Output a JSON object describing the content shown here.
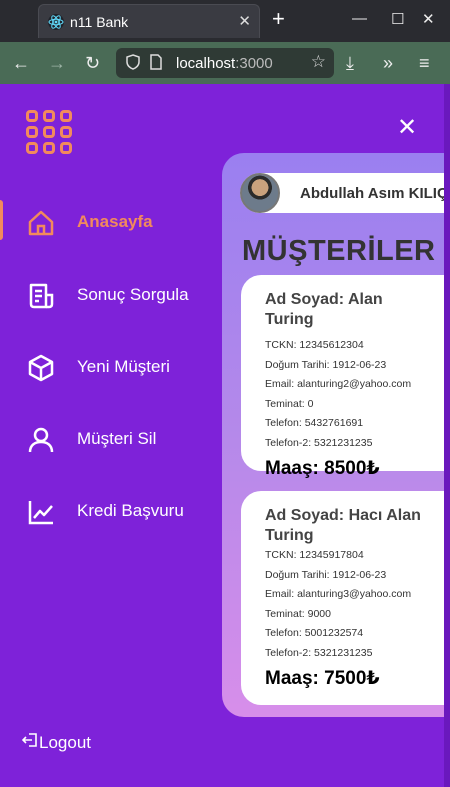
{
  "browser": {
    "tab_title": "n11 Bank",
    "url_host": "localhost",
    "url_port": ":3000"
  },
  "sidebar": {
    "items": [
      {
        "label": "Anasayfa",
        "icon": "home-icon",
        "active": true
      },
      {
        "label": "Sonuç Sorgula",
        "icon": "receipt-icon"
      },
      {
        "label": "Yeni Müşteri",
        "icon": "cube-icon"
      },
      {
        "label": "Müşteri Sil",
        "icon": "user-icon"
      },
      {
        "label": "Kredi Başvuru",
        "icon": "chart-line-icon"
      }
    ],
    "logout_label": "Logout",
    "accent_color": "#f28a5c"
  },
  "header": {
    "user_name": "Abdullah Asım KILIÇ"
  },
  "main": {
    "title": "MÜŞTERİLER",
    "customers": [
      {
        "name": "Ad Soyad: Alan Turing",
        "tckn": "TCKN: 12345612304",
        "birth": "Doğum Tarihi: 1912-06-23",
        "email": "Email: alanturing2@yahoo.com",
        "collateral": "Teminat: 0",
        "phone": "Telefon: 5432761691",
        "phone2": "Telefon-2: 5321231235",
        "salary": "Maaş: 8500₺"
      },
      {
        "name": "Ad Soyad: Hacı Alan Turing",
        "tckn": "TCKN: 12345917804",
        "birth": "Doğum Tarihi: 1912-06-23",
        "email": "Email: alanturing3@yahoo.com",
        "collateral": "Teminat: 9000",
        "phone": "Telefon: 5001232574",
        "phone2": "Telefon-2: 5321231235",
        "salary": "Maaş: 7500₺"
      }
    ]
  }
}
